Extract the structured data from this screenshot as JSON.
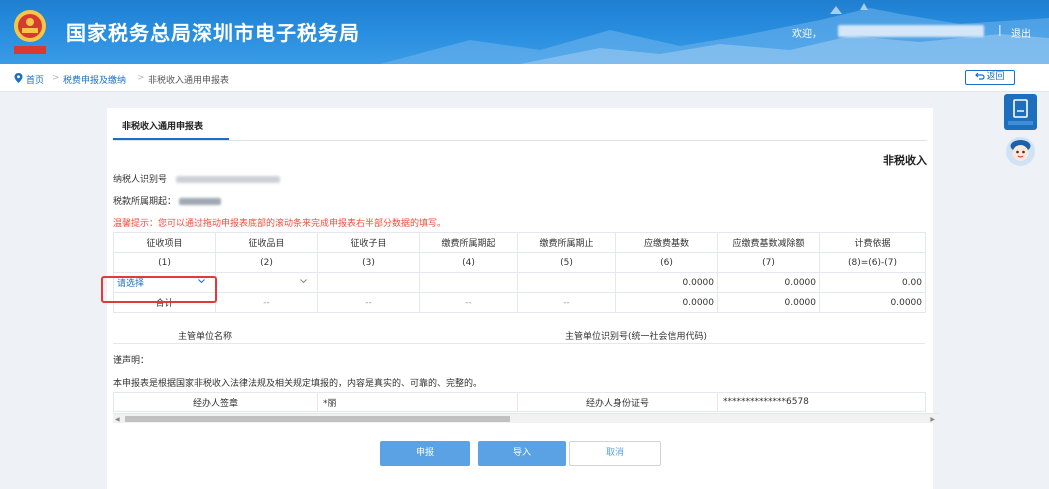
{
  "header": {
    "title": "国家税务总局深圳市电子税务局",
    "welcome": "欢迎，",
    "separator": "|",
    "logout": "退出"
  },
  "breadcrumb": {
    "home": "首页",
    "arrow": ">",
    "level1": "税费申报及缴纳",
    "level2": "非税收入通用申报表"
  },
  "back_label": "返回",
  "tab_label": "非税收入通用申报表",
  "form_title": "非税收入",
  "taxpayer_id_label": "纳税人识别号",
  "period_label": "税款所属期起：",
  "hint": "温馨提示：您可以通过拖动申报表底部的滚动条来完成申报表右半部分数据的填写。",
  "table": {
    "headers": [
      "征收项目",
      "征收品目",
      "征收子目",
      "缴费所属期起",
      "缴费所属期止",
      "应缴费基数",
      "应缴费基数减除额",
      "计费依据"
    ],
    "indices": [
      "(1)",
      "(2)",
      "(3)",
      "(4)",
      "(5)",
      "(6)",
      "(7)",
      "(8)=(6)-(7)"
    ],
    "input_row": {
      "select_placeholder": "请选择",
      "base": "0.0000",
      "deduction": "0.0000",
      "basis": "0.00"
    },
    "total_row": {
      "label": "合计",
      "dash": "--",
      "base": "0.0000",
      "deduction": "0.0000",
      "basis": "0.0000"
    }
  },
  "authority_label": "主管单位名称",
  "authority_id_label": "主管单位识别号(统一社会信用代码)",
  "declaration_title": "谨声明：",
  "declaration_text": "本申报表是根据国家非税收入法律法规及相关规定填报的，内容是真实的、可靠的、完整的。",
  "signature": {
    "agent_label": "经办人签章",
    "agent_value": "*丽",
    "id_label": "经办人身份证号",
    "id_value": "**************6578"
  },
  "buttons": {
    "submit": "申报",
    "import": "导入",
    "cancel": "取消"
  },
  "colors": {
    "header_blue": "#2a8fe0",
    "link_blue": "#1a6fc4",
    "hint_red": "#f24d3a",
    "button_blue": "#5aa2e4",
    "highlight_red": "#e23a3a"
  }
}
